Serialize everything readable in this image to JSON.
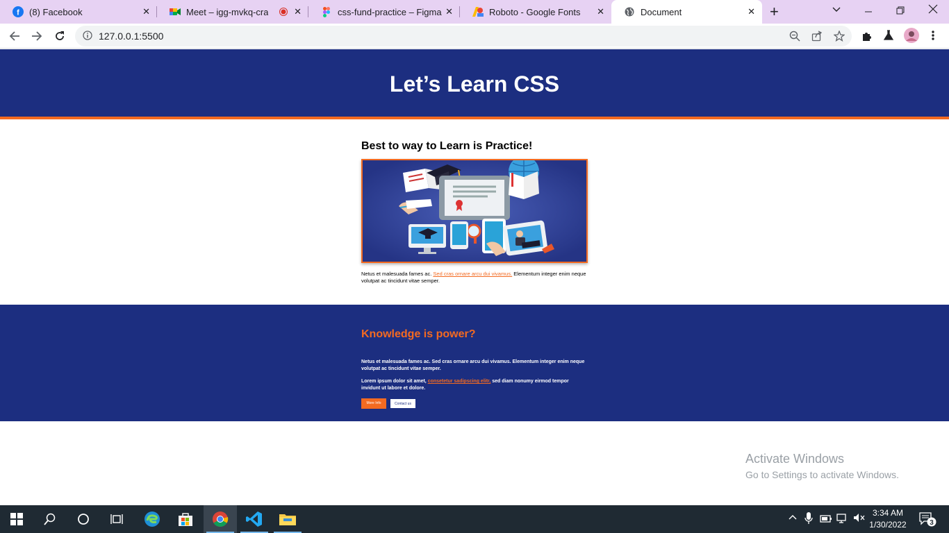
{
  "browser": {
    "tabs": [
      {
        "title": "(8) Facebook",
        "favicon": "facebook-icon"
      },
      {
        "title": "Meet – igg-mvkq-cra",
        "favicon": "google-meet-icon",
        "recording": true
      },
      {
        "title": "css-fund-practice – Figma",
        "favicon": "figma-icon"
      },
      {
        "title": "Roboto - Google Fonts",
        "favicon": "google-fonts-icon"
      },
      {
        "title": "Document",
        "favicon": "globe-icon",
        "active": true
      }
    ],
    "url": "127.0.0.1:5500"
  },
  "page": {
    "hero_title": "Let’s Learn CSS",
    "section_heading": "Best to way to Learn is Practice!",
    "para1_pre": "Netus et malesuada fames ac. ",
    "para1_link": "Sed cras ornare arcu dui vivamus.",
    "para1_post": " Elementum integer enim neque volutpat ac tincidunt vitae semper.",
    "dark_heading": "Knowledge is power?",
    "dark_para1": "Netus et malesuada fames ac. Sed cras ornare arcu dui vivamus. Elementum integer enim neque volutpat ac tincidunt vitae semper.",
    "dark_para2_pre": "Lorem ipsum dolor sit amet, ",
    "dark_para2_link": "consetetur sadipscing elitr,",
    "dark_para2_post": " sed diam nonumy eirmod tempor invidunt ut labore et dolore.",
    "btn_more": "More Info",
    "btn_contact": "Contact us"
  },
  "watermark": {
    "line1": "Activate Windows",
    "line2": "Go to Settings to activate Windows."
  },
  "taskbar": {
    "time": "3:34 AM",
    "date": "1/30/2022",
    "notifications": "3"
  },
  "colors": {
    "navy": "#1c2e80",
    "orange": "#f36a21",
    "tabstrip": "#e7d2f3"
  }
}
